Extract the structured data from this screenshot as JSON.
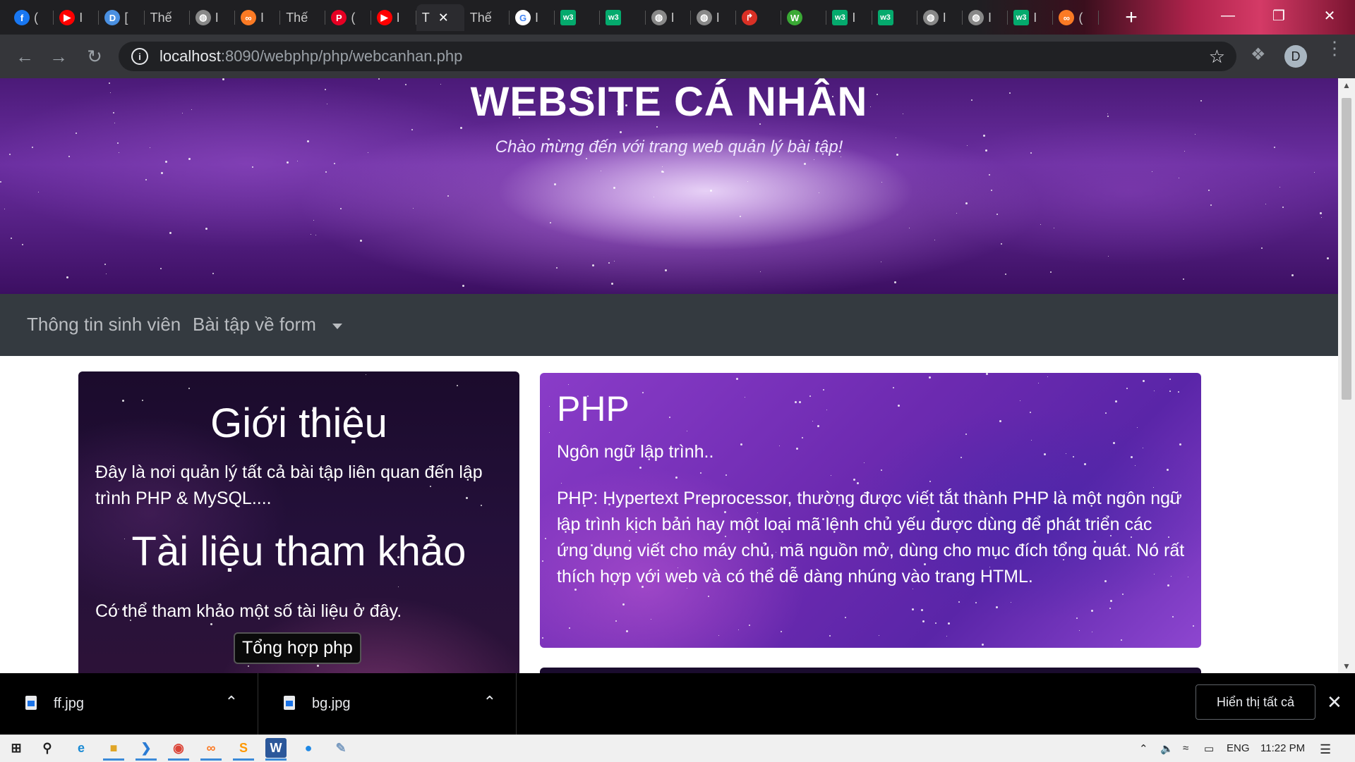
{
  "browser": {
    "tabs": [
      {
        "title": "(",
        "favicon": "facebook-icon",
        "color": "#1877f2"
      },
      {
        "title": "I",
        "favicon": "youtube-icon",
        "color": "#ff0000"
      },
      {
        "title": "[",
        "favicon": "doc-icon",
        "color": "#4a90e2"
      },
      {
        "title": "Thế",
        "favicon": "",
        "color": ""
      },
      {
        "title": "I",
        "favicon": "globe-icon",
        "color": "#888888"
      },
      {
        "title": "I",
        "favicon": "xampp-icon",
        "color": "#fb7a24"
      },
      {
        "title": "Thế",
        "favicon": "",
        "color": ""
      },
      {
        "title": "(",
        "favicon": "pinterest-icon",
        "color": "#e60023"
      },
      {
        "title": "I",
        "favicon": "youtube-icon",
        "color": "#ff0000"
      },
      {
        "title": "T",
        "favicon": "",
        "color": "",
        "active": true
      },
      {
        "title": "Thế",
        "favicon": "",
        "color": ""
      },
      {
        "title": "I",
        "favicon": "google-icon",
        "color": "#ffffff"
      },
      {
        "title": "",
        "favicon": "w3schools-icon",
        "color": "#04aa6d"
      },
      {
        "title": "",
        "favicon": "w3schools-icon",
        "color": "#04aa6d"
      },
      {
        "title": "I",
        "favicon": "globe-icon",
        "color": "#888888"
      },
      {
        "title": "I",
        "favicon": "globe-icon",
        "color": "#888888"
      },
      {
        "title": "",
        "favicon": "redirect-icon",
        "color": "#d93025"
      },
      {
        "title": "",
        "favicon": "w-icon",
        "color": "#3aa935"
      },
      {
        "title": "I",
        "favicon": "w3schools-icon",
        "color": "#04aa6d"
      },
      {
        "title": "",
        "favicon": "w3schools-icon",
        "color": "#04aa6d"
      },
      {
        "title": "I",
        "favicon": "globe-icon",
        "color": "#888888"
      },
      {
        "title": "I",
        "favicon": "globe-icon",
        "color": "#888888"
      },
      {
        "title": "I",
        "favicon": "w3schools-icon",
        "color": "#04aa6d"
      },
      {
        "title": "(",
        "favicon": "xampp-icon",
        "color": "#fb7a24"
      }
    ],
    "url_host": "localhost",
    "url_path": ":8090/webphp/php/webcanhan.php",
    "profile_initial": "D"
  },
  "banner": {
    "title": "WEBSITE CÁ NHÂN",
    "subtitle": "Chào mừng đến với trang web quản lý bài tập!"
  },
  "nav": {
    "item1": "Thông tin sinh viên",
    "item2": "Bài tập về form"
  },
  "left_card": {
    "heading1": "Giới thiệu",
    "text1": "Đây là nơi quản lý tất cả bài tập liên quan đến lập trình PHP & MySQL....",
    "heading2": "Tài liệu tham khảo",
    "text2": "Có thể tham khảo một số tài liệu ở đây.",
    "button": "Tổng hợp php"
  },
  "right_card": {
    "heading": "PHP",
    "lead": "Ngôn ngữ lập trình..",
    "body": "PHP: Hypertext Preprocessor, thường được viết tắt thành PHP là một ngôn ngữ lập trình kịch bản hay một loại mã lệnh chủ yếu được dùng để phát triển các ứng dụng viết cho máy chủ, mã nguồn mở, dùng cho mục đích tổng quát. Nó rất thích hợp với web và có thể dễ dàng nhúng vào trang HTML."
  },
  "downloads": {
    "items": [
      {
        "name": "ff.jpg"
      },
      {
        "name": "bg.jpg"
      }
    ],
    "show_all": "Hiển thị tất cả"
  },
  "taskbar": {
    "lang": "ENG",
    "time": "11:22 PM"
  }
}
